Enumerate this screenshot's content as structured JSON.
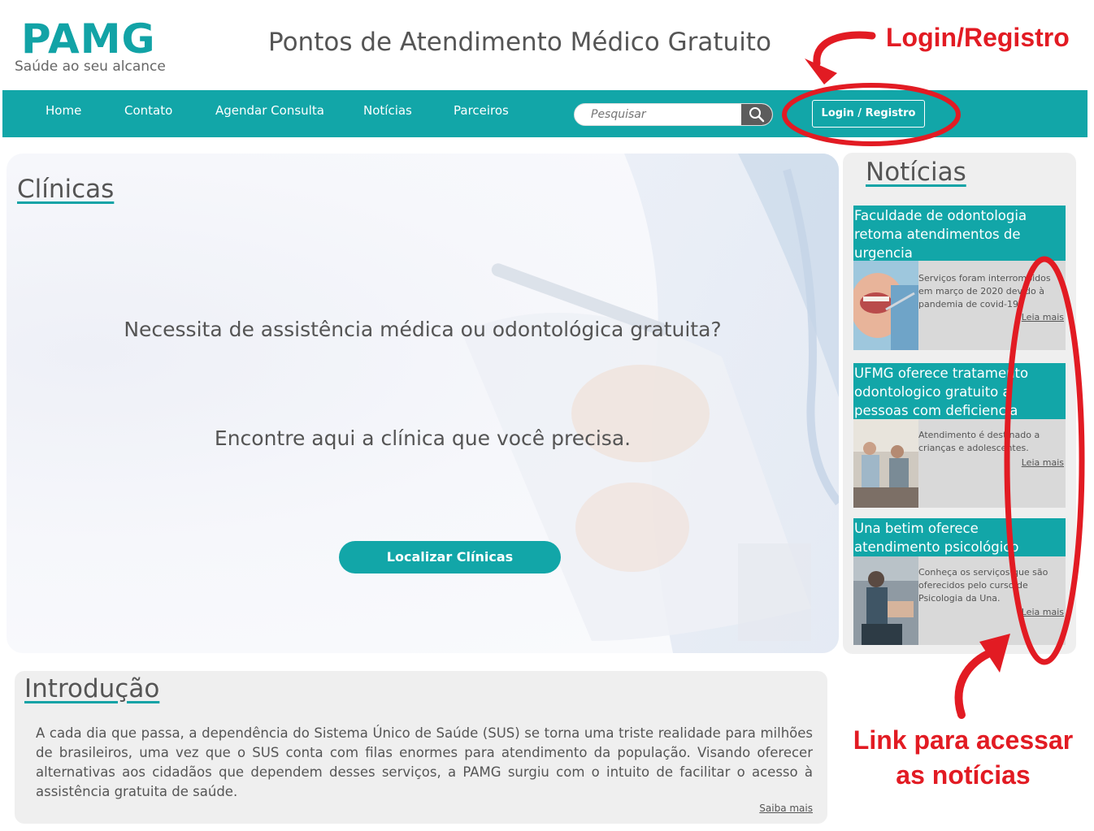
{
  "brand": {
    "logo_text": "PAMG",
    "tagline": "Saúde ao seu alcance",
    "site_title": "Pontos de Atendimento Médico Gratuito",
    "accent_color": "#12a6a8"
  },
  "nav": {
    "items": [
      "Home",
      "Contato",
      "Agendar Consulta",
      "Notícias",
      "Parceiros"
    ],
    "search_placeholder": "Pesquisar",
    "login_label": "Login / Registro"
  },
  "hero": {
    "title": "Clínicas",
    "question": "Necessita de assistência médica ou odontológica gratuita?",
    "subtitle": "Encontre aqui a clínica que você precisa.",
    "button_label": "Localizar Clínicas"
  },
  "news": {
    "title": "Notícias",
    "items": [
      {
        "headline": "Faculdade de odontologia retoma atendimentos de urgencia",
        "summary": "Serviços foram interrompidos em março de 2020 devido à pandemia de covid-19.",
        "more": "Leia mais"
      },
      {
        "headline": "UFMG oferece tratamento odontologico gratuito a pessoas com deficiencia",
        "summary": "Atendimento é destinado a crianças e adolescentes.",
        "more": "Leia mais"
      },
      {
        "headline": "Una betim oferece atendimento psicológico gratuito",
        "summary": "Conheça os serviços que são oferecidos pelo curso de Psicologia da Una.",
        "more": "Leia mais"
      }
    ]
  },
  "intro": {
    "title": "Introdução",
    "text": "A cada dia que passa, a dependência do Sistema Único de Saúde (SUS) se torna uma triste realidade para milhões de brasileiros, uma vez que o SUS conta com filas enormes para atendimento da população. Visando oferecer alternativas aos cidadãos que dependem desses serviços, a PAMG surgiu com o intuito de facilitar o acesso à assistência gratuita de saúde.",
    "more": "Saiba mais"
  },
  "annotations": {
    "login": "Login/Registro",
    "news_link_line1": "Link para acessar",
    "news_link_line2": "as notícias",
    "color": "#e21b23"
  },
  "icons": [
    "search-icon"
  ]
}
